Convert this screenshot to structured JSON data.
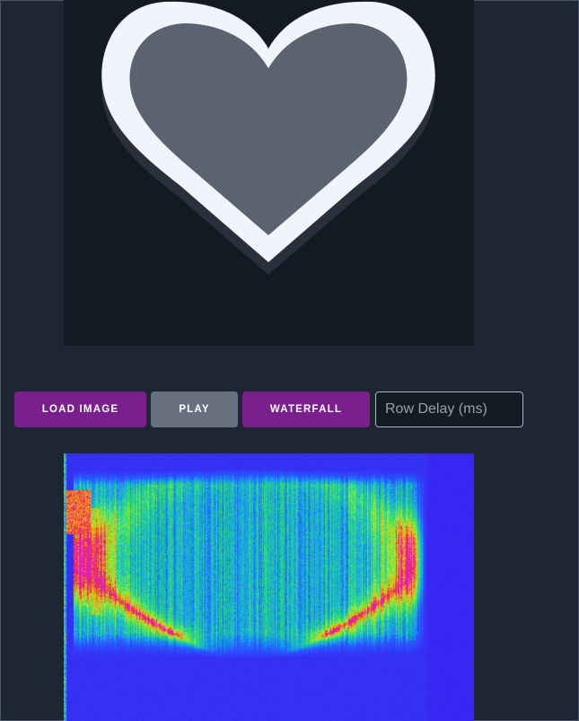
{
  "preview": {
    "icon": "heart-icon",
    "background_color": "#141a24",
    "heart_outline_color": "#f1f4fa",
    "heart_fill_color": "#5b6270"
  },
  "controls": {
    "load_image_label": "LOAD IMAGE",
    "play_label": "PLAY",
    "waterfall_label": "WATERFALL",
    "row_delay_placeholder": "Row Delay (ms)",
    "row_delay_value": ""
  },
  "colors": {
    "page_background": "#1f2633",
    "primary_button": "#7a1f8e",
    "secondary_button": "#66707f",
    "spectrogram_background": "#3b1ff0"
  }
}
